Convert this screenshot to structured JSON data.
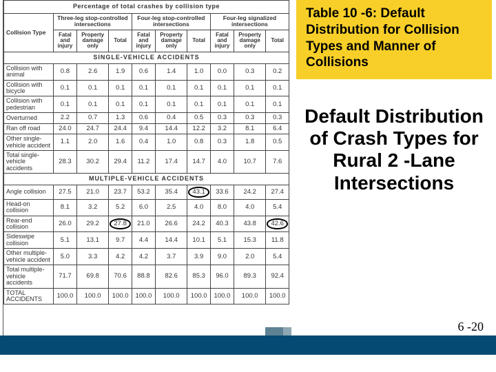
{
  "table": {
    "top_banner": "Percentage of total crashes by collision type",
    "control_headers": [
      "Three-leg stop-controlled intersections",
      "Four-leg stop-controlled intersections",
      "Four-leg signalized intersections"
    ],
    "sub_headers": [
      "Fatal and injury",
      "Property damage only",
      "Total"
    ],
    "row_label_header": "Collision Type",
    "section1": "SINGLE-VEHICLE ACCIDENTS",
    "section2": "MULTIPLE-VEHICLE ACCIDENTS",
    "rows_single": [
      {
        "label": "Collision with animal",
        "v": [
          "0.8",
          "2.6",
          "1.9",
          "0.6",
          "1.4",
          "1.0",
          "0.0",
          "0.3",
          "0.2"
        ]
      },
      {
        "label": "Collision with bicycle",
        "v": [
          "0.1",
          "0.1",
          "0.1",
          "0.1",
          "0.1",
          "0.1",
          "0.1",
          "0.1",
          "0.1"
        ]
      },
      {
        "label": "Collision with pedestrian",
        "v": [
          "0.1",
          "0.1",
          "0.1",
          "0.1",
          "0.1",
          "0.1",
          "0.1",
          "0.1",
          "0.1"
        ]
      },
      {
        "label": "Overturned",
        "v": [
          "2.2",
          "0.7",
          "1.3",
          "0.6",
          "0.4",
          "0.5",
          "0.3",
          "0.3",
          "0.3"
        ]
      },
      {
        "label": "Ran off road",
        "v": [
          "24.0",
          "24.7",
          "24.4",
          "9.4",
          "14.4",
          "12.2",
          "3.2",
          "8.1",
          "6.4"
        ]
      },
      {
        "label": "Other single-vehicle accident",
        "v": [
          "1.1",
          "2.0",
          "1.6",
          "0.4",
          "1.0",
          "0.8",
          "0.3",
          "1.8",
          "0.5"
        ]
      },
      {
        "label": "Total single-vehicle accidents",
        "v": [
          "28.3",
          "30.2",
          "29.4",
          "11.2",
          "17.4",
          "14.7",
          "4.0",
          "10.7",
          "7.6"
        ]
      }
    ],
    "rows_multi": [
      {
        "label": "Angle collision",
        "v": [
          "27.5",
          "21.0",
          "23.7",
          "53.2",
          "35.4",
          "43.1",
          "33.6",
          "24.2",
          "27.4"
        ],
        "circle": [
          5
        ]
      },
      {
        "label": "Head-on collision",
        "v": [
          "8.1",
          "3.2",
          "5.2",
          "6.0",
          "2.5",
          "4.0",
          "8.0",
          "4.0",
          "5.4"
        ]
      },
      {
        "label": "Rear-end collision",
        "v": [
          "26.0",
          "29.2",
          "27.8",
          "21.0",
          "26.6",
          "24.2",
          "40.3",
          "43.8",
          "42.6"
        ],
        "circle": [
          2,
          8
        ]
      },
      {
        "label": "Sideswipe collision",
        "v": [
          "5.1",
          "13.1",
          "9.7",
          "4.4",
          "14.4",
          "10.1",
          "5.1",
          "15.3",
          "11.8"
        ]
      },
      {
        "label": "Other multiple-vehicle accident",
        "v": [
          "5.0",
          "3.3",
          "4.2",
          "4.2",
          "3.7",
          "3.9",
          "9.0",
          "2.0",
          "5.4"
        ]
      },
      {
        "label": "Total multiple-vehicle accidents",
        "v": [
          "71.7",
          "69.8",
          "70.6",
          "88.8",
          "82.6",
          "85.3",
          "96.0",
          "89.3",
          "92.4"
        ]
      }
    ],
    "total_row": {
      "label": "TOTAL ACCIDENTS",
      "v": [
        "100.0",
        "100.0",
        "100.0",
        "100.0",
        "100.0",
        "100.0",
        "100.0",
        "100.0",
        "100.0"
      ]
    }
  },
  "chart_data": {
    "type": "table",
    "title": "Percentage of total crashes by collision type",
    "column_groups": [
      "Three-leg stop-controlled intersections",
      "Four-leg stop-controlled intersections",
      "Four-leg signalized intersections"
    ],
    "sub_columns": [
      "Fatal and injury",
      "Property damage only",
      "Total"
    ],
    "sections": [
      {
        "name": "SINGLE-VEHICLE ACCIDENTS",
        "rows": [
          {
            "label": "Collision with animal",
            "values": [
              0.8,
              2.6,
              1.9,
              0.6,
              1.4,
              1.0,
              0.0,
              0.3,
              0.2
            ]
          },
          {
            "label": "Collision with bicycle",
            "values": [
              0.1,
              0.1,
              0.1,
              0.1,
              0.1,
              0.1,
              0.1,
              0.1,
              0.1
            ]
          },
          {
            "label": "Collision with pedestrian",
            "values": [
              0.1,
              0.1,
              0.1,
              0.1,
              0.1,
              0.1,
              0.1,
              0.1,
              0.1
            ]
          },
          {
            "label": "Overturned",
            "values": [
              2.2,
              0.7,
              1.3,
              0.6,
              0.4,
              0.5,
              0.3,
              0.3,
              0.3
            ]
          },
          {
            "label": "Ran off road",
            "values": [
              24.0,
              24.7,
              24.4,
              9.4,
              14.4,
              12.2,
              3.2,
              8.1,
              6.4
            ]
          },
          {
            "label": "Other single-vehicle accident",
            "values": [
              1.1,
              2.0,
              1.6,
              0.4,
              1.0,
              0.8,
              0.3,
              1.8,
              0.5
            ]
          },
          {
            "label": "Total single-vehicle accidents",
            "values": [
              28.3,
              30.2,
              29.4,
              11.2,
              17.4,
              14.7,
              4.0,
              10.7,
              7.6
            ]
          }
        ]
      },
      {
        "name": "MULTIPLE-VEHICLE ACCIDENTS",
        "rows": [
          {
            "label": "Angle collision",
            "values": [
              27.5,
              21.0,
              23.7,
              53.2,
              35.4,
              43.1,
              33.6,
              24.2,
              27.4
            ]
          },
          {
            "label": "Head-on collision",
            "values": [
              8.1,
              3.2,
              5.2,
              6.0,
              2.5,
              4.0,
              8.0,
              4.0,
              5.4
            ]
          },
          {
            "label": "Rear-end collision",
            "values": [
              26.0,
              29.2,
              27.8,
              21.0,
              26.6,
              24.2,
              40.3,
              43.8,
              42.6
            ]
          },
          {
            "label": "Sideswipe collision",
            "values": [
              5.1,
              13.1,
              9.7,
              4.4,
              14.4,
              10.1,
              5.1,
              15.3,
              11.8
            ]
          },
          {
            "label": "Other multiple-vehicle accident",
            "values": [
              5.0,
              3.3,
              4.2,
              4.2,
              3.7,
              3.9,
              9.0,
              2.0,
              5.4
            ]
          },
          {
            "label": "Total multiple-vehicle accidents",
            "values": [
              71.7,
              69.8,
              70.6,
              88.8,
              82.6,
              85.3,
              96.0,
              89.3,
              92.4
            ]
          }
        ]
      }
    ],
    "totals": {
      "label": "TOTAL ACCIDENTS",
      "values": [
        100.0,
        100.0,
        100.0,
        100.0,
        100.0,
        100.0,
        100.0,
        100.0,
        100.0
      ]
    }
  },
  "callout": {
    "caption": "Table 10 -6: Default Distribution for Collision Types and Manner of Collisions",
    "big_title": "Default Distribution of Crash Types for Rural 2 -Lane Intersections"
  },
  "page_number": "6 -20"
}
